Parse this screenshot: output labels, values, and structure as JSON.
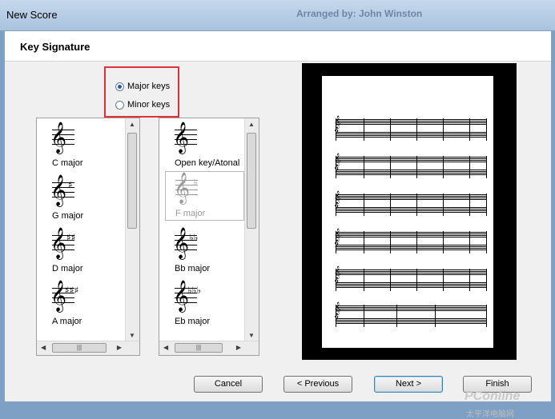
{
  "window": {
    "title": "New Score",
    "background_title": "Arranged by: John Winston"
  },
  "header": {
    "title": "Key Signature"
  },
  "mode": {
    "major_label": "Major keys",
    "minor_label": "Minor keys",
    "selected": "major"
  },
  "sharp_keys": [
    {
      "label": "C major",
      "glyph": "",
      "sharps": 0
    },
    {
      "label": "G major",
      "glyph": "♯",
      "sharps": 1
    },
    {
      "label": "D major",
      "glyph": "♯♯",
      "sharps": 2
    },
    {
      "label": "A major",
      "glyph": "♯♯♯",
      "sharps": 3
    }
  ],
  "flat_keys": [
    {
      "label": "Open key/Atonal",
      "glyph": "",
      "flats": 0
    },
    {
      "label": "F major",
      "glyph": "♭",
      "flats": 1,
      "selected": true
    },
    {
      "label": "Bb major",
      "glyph": "♭♭",
      "flats": 2
    },
    {
      "label": "Eb major",
      "glyph": "♭♭♭",
      "flats": 3
    }
  ],
  "buttons": {
    "cancel": "Cancel",
    "previous": "< Previous",
    "next": "Next >",
    "finish": "Finish"
  },
  "watermark": {
    "brand": "PConline",
    "sub": "太平洋电脑网"
  },
  "colors": {
    "highlight": "#e0303a",
    "accent": "#1f5fa8"
  }
}
